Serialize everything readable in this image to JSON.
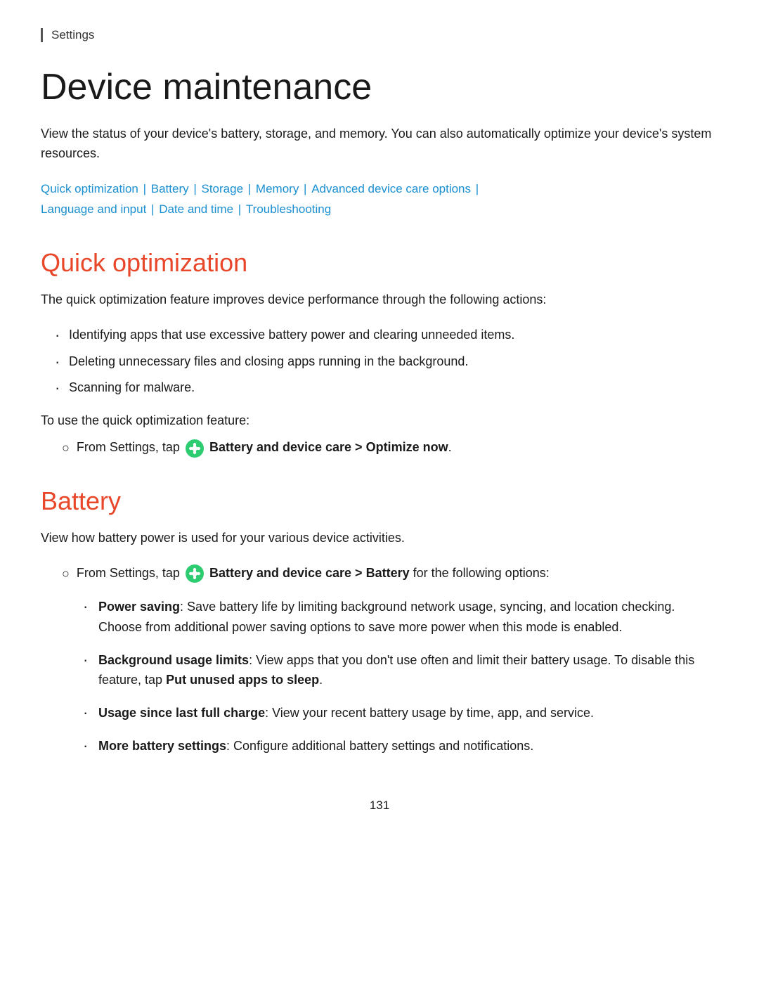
{
  "breadcrumb": {
    "label": "Settings"
  },
  "page": {
    "title": "Device maintenance",
    "intro": "View the status of your device's battery, storage, and memory. You can also automatically optimize your device's system resources."
  },
  "nav": {
    "links": [
      {
        "label": "Quick optimization",
        "href": "#quick-optimization"
      },
      {
        "label": "Battery",
        "href": "#battery"
      },
      {
        "label": "Storage",
        "href": "#storage"
      },
      {
        "label": "Memory",
        "href": "#memory"
      },
      {
        "label": "Advanced device care options",
        "href": "#advanced"
      },
      {
        "label": "Language and input",
        "href": "#language"
      },
      {
        "label": "Date and time",
        "href": "#datetime"
      },
      {
        "label": "Troubleshooting",
        "href": "#troubleshooting"
      }
    ]
  },
  "sections": {
    "quick_optimization": {
      "title": "Quick optimization",
      "description": "The quick optimization feature improves device performance through the following actions:",
      "bullets": [
        "Identifying apps that use excessive battery power and clearing unneeded items.",
        "Deleting unnecessary files and closing apps running in the background.",
        "Scanning for malware."
      ],
      "to_use": "To use the quick optimization feature:",
      "step": "From Settings, tap",
      "step_bold": "Battery and device care > Optimize now",
      "step_suffix": "."
    },
    "battery": {
      "title": "Battery",
      "description": "View how battery power is used for your various device activities.",
      "step": "From Settings, tap",
      "step_bold": "Battery and device care > Battery",
      "step_suffix": "for the following options:",
      "options": [
        {
          "label": "Power saving",
          "label_suffix": ": Save battery life by limiting background network usage, syncing, and location checking. Choose from additional power saving options to save more power when this mode is enabled."
        },
        {
          "label": "Background usage limits",
          "label_suffix": ": View apps that you don’t use often and limit their battery usage. To disable this feature, tap ",
          "put_unused": "Put unused apps to sleep",
          "label_end": "."
        },
        {
          "label": "Usage since last full charge",
          "label_suffix": ": View your recent battery usage by time, app, and service."
        },
        {
          "label": "More battery settings",
          "label_suffix": ": Configure additional battery settings and notifications."
        }
      ]
    }
  },
  "footer": {
    "page_number": "131"
  },
  "colors": {
    "link": "#1a8fd1",
    "section_title": "#e8472a",
    "text": "#1a1a1a",
    "icon_green": "#2ecc71"
  }
}
